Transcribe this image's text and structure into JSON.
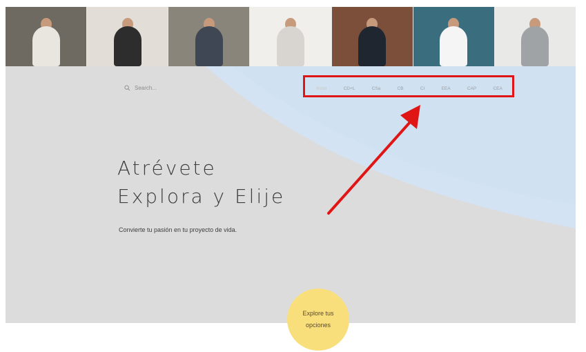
{
  "photo_strip": {
    "photos": [
      {
        "subject": "man in suit at desk",
        "color": "#6e6a62"
      },
      {
        "subject": "woman with camera tripod",
        "color": "#e2ddd6"
      },
      {
        "subject": "man standing arms crossed",
        "color": "#8a857a"
      },
      {
        "subject": "woman thinking",
        "color": "#f0efec"
      },
      {
        "subject": "man in library office",
        "color": "#7b4f3a"
      },
      {
        "subject": "woman smiling",
        "color": "#3a6e7e"
      },
      {
        "subject": "man with camera",
        "color": "#e9e9e8"
      }
    ]
  },
  "header": {
    "search_placeholder": "Search...",
    "search_icon": "search-icon"
  },
  "nav": {
    "items": [
      "Inicio",
      "CD+L",
      "CSa",
      "CB",
      "CI",
      "EEA",
      "CAP",
      "CEA"
    ]
  },
  "hero": {
    "headline_line1": "Atrévete",
    "headline_line2": "Explora y Elije",
    "subtitle": "Convierte tu pasión en tu proyecto de vida."
  },
  "cta": {
    "line1": "Explore tus",
    "line2": "opciones"
  },
  "colors": {
    "hero_gray": "#dcdcdd",
    "hero_blue": "#cfe0f0",
    "highlight_red": "#e01616",
    "cta_yellow": "#f9df7c"
  }
}
